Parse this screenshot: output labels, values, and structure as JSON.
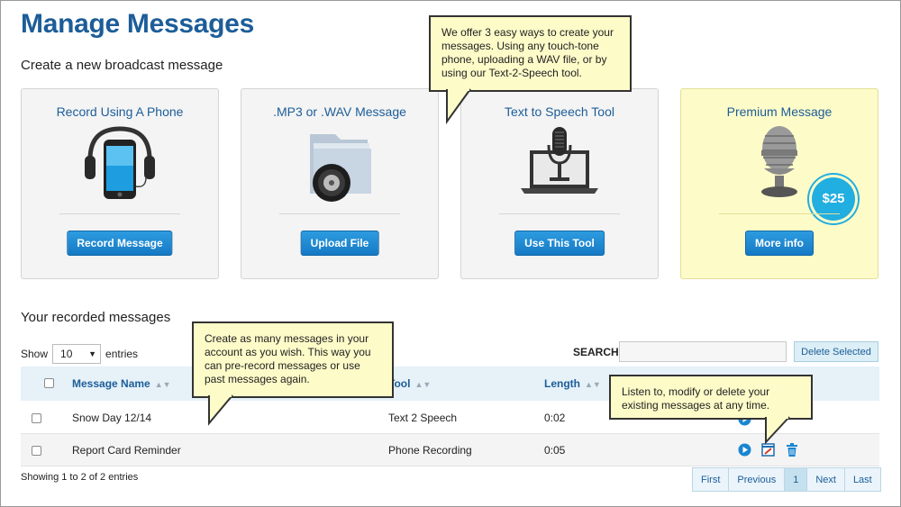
{
  "page": {
    "title": "Manage Messages",
    "create_heading": "Create a new broadcast message",
    "recorded_heading": "Your recorded messages"
  },
  "cards": [
    {
      "title": "Record Using A Phone",
      "button": "Record Message",
      "icon": "phone-headphones-icon"
    },
    {
      "title": ".MP3 or .WAV Message",
      "button": "Upload File",
      "icon": "audio-folder-icon"
    },
    {
      "title": "Text to Speech Tool",
      "button": "Use This Tool",
      "icon": "laptop-microphone-icon"
    },
    {
      "title": "Premium Message",
      "button": "More info",
      "icon": "studio-microphone-icon",
      "badge": "$25"
    }
  ],
  "callouts": {
    "ways": "We offer 3 easy ways to create your messages.  Using any touch-tone phone, uploading a WAV file, or by using our Text-2-Speech tool.",
    "create": "Create as many messages in your account as you wish.  This way you can pre-record messages or use past messages again.",
    "listen": "Listen to, modify or delete your existing messages at any time."
  },
  "controls": {
    "show_label": "Show",
    "entries_value": "10",
    "entries_label": "entries",
    "search_label": "SEARCH:",
    "delete_selected": "Delete Selected"
  },
  "table": {
    "columns": [
      "Message Name",
      "Tool",
      "Length"
    ],
    "rows": [
      {
        "name": "Snow Day 12/14",
        "tool": "Text 2 Speech",
        "length": "0:02"
      },
      {
        "name": "Report Card Reminder",
        "tool": "Phone Recording",
        "length": "0:05"
      }
    ]
  },
  "footer": {
    "info": "Showing 1 to 2 of 2 entries",
    "pager": [
      "First",
      "Previous",
      "1",
      "Next",
      "Last"
    ]
  },
  "colors": {
    "title_blue": "#1c5d99",
    "button_blue": "#1a86d0",
    "premium_bg": "#fdfbc8",
    "badge": "#21aee0",
    "callout_bg": "#fdfbc8"
  }
}
